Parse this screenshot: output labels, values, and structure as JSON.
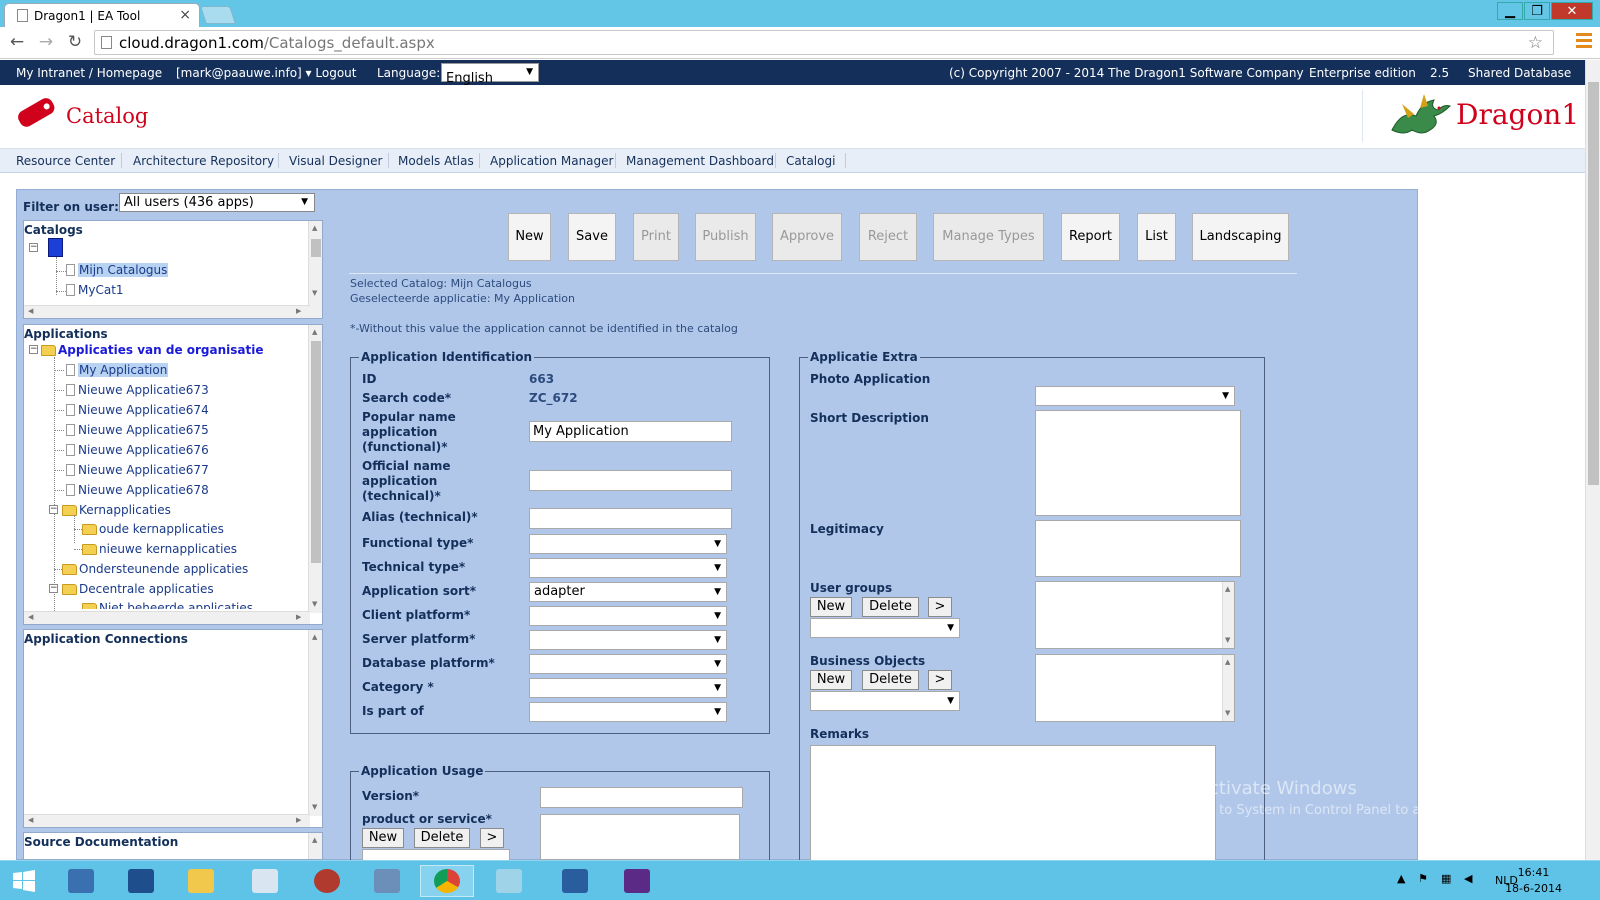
{
  "browser": {
    "tab_title": "Dragon1 | EA Tool",
    "tab_close": "×",
    "url_host": "cloud.dragon1.com",
    "url_path": "/Catalogs_default.aspx",
    "back": "←",
    "forward": "→",
    "reload": "↻",
    "star": "☆",
    "win_min": "▁",
    "win_max": "❐",
    "win_close": "✕"
  },
  "topbar": {
    "intranet": "My Intranet / Homepage",
    "user": "[mark@paauwe.info] ▾ Logout",
    "language_label": "Language:",
    "language_value": "English",
    "copyright": "(c) Copyright 2007 - 2014 The Dragon1 Software Company",
    "edition": "Enterprise edition",
    "version": "2.5",
    "database": "Shared Database"
  },
  "header": {
    "title": "Catalog",
    "brand": "Dragon1"
  },
  "nav": [
    "Resource Center",
    "Architecture Repository",
    "Visual Designer",
    "Models Atlas",
    "Application Manager",
    "Management Dashboard",
    "Catalogi"
  ],
  "left": {
    "filter_label": "Filter on user:",
    "filter_value": "All users (436 apps)",
    "catalogs_label": "Catalogs",
    "catalogs": [
      "Mijn Catalogus",
      "MyCat1"
    ],
    "applications_label": "Applications",
    "apps_root": "Applicaties van de organisatie",
    "apps": [
      "My Application",
      "Nieuwe Applicatie673",
      "Nieuwe Applicatie674",
      "Nieuwe Applicatie675",
      "Nieuwe Applicatie676",
      "Nieuwe Applicatie677",
      "Nieuwe Applicatie678"
    ],
    "folder_kern": "Kernapplicaties",
    "folder_oude": "oude kernapplicaties",
    "folder_nieuwe": "nieuwe kernapplicaties",
    "folder_onder": "Ondersteunende applicaties",
    "folder_decentraal": "Decentrale applicaties",
    "folder_niet": "Niet beheerde applicaties",
    "connections_label": "Application Connections",
    "source_label": "Source Documentation"
  },
  "toolbar": {
    "new": "New",
    "save": "Save",
    "print": "Print",
    "publish": "Publish",
    "approve": "Approve",
    "reject": "Reject",
    "manage_types": "Manage Types",
    "report": "Report",
    "list": "List",
    "landscaping": "Landscaping"
  },
  "info": {
    "selected_catalog": "Selected Catalog: Mijn Catalogus",
    "selected_app": "Geselecteerde applicatie: My Application",
    "note": "*-Without this value the application cannot be identified in the catalog"
  },
  "identification": {
    "legend": "Application Identification",
    "id_label": "ID",
    "id_value": "663",
    "search_label": "Search code*",
    "search_value": "ZC_672",
    "popular_label": "Popular name application (functional)*",
    "popular_value": "My Application",
    "official_label": "Official name application (technical)*",
    "official_value": "",
    "alias_label": "Alias (technical)*",
    "functional_type": "Functional type*",
    "technical_type": "Technical type*",
    "app_sort": "Application sort*",
    "app_sort_value": "adapter",
    "client_platform": "Client platform*",
    "server_platform": "Server platform*",
    "database_platform": "Database platform*",
    "category": "Category *",
    "is_part_of": "Is part of"
  },
  "usage": {
    "legend": "Application Usage",
    "version": "Version*",
    "product": "product or service*",
    "new": "New",
    "delete": "Delete",
    "more": ">"
  },
  "extra": {
    "legend": "Applicatie Extra",
    "photo": "Photo Application",
    "short_desc": "Short Description",
    "legitimacy": "Legitimacy",
    "user_groups": "User groups",
    "business_objects": "Business Objects",
    "remarks": "Remarks",
    "new": "New",
    "delete": "Delete",
    "more": ">"
  },
  "watermark": {
    "line1": "Activate Windows",
    "line2": "Go to System in Control Panel to activate Windows."
  },
  "taskbar": {
    "lang": "NLD",
    "time": "16:41",
    "date": "18-6-2014"
  },
  "colors": {
    "topbar": "#14305a",
    "panel": "#b0c7ea",
    "brand_red": "#d0021b",
    "taskbar": "#5fc3e8"
  }
}
